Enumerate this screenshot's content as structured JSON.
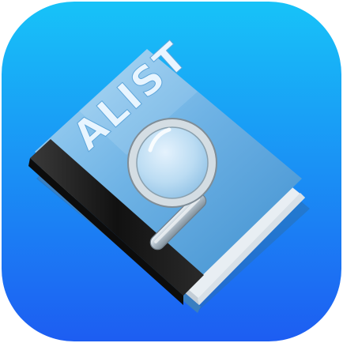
{
  "app_icon": {
    "book_title": "ALIST",
    "icons": {
      "book": "book-icon",
      "magnifier": "magnifying-glass-icon"
    },
    "colors": {
      "background_top": "#17c3f8",
      "background_bottom": "#1d5df2",
      "book_cover_light": "#a7d6f4",
      "book_cover_dark": "#3f8fcf",
      "book_spine": "#1c1c1c",
      "title_text": "#e8f5ff",
      "magnifier_handle": "#c9d6df"
    }
  }
}
